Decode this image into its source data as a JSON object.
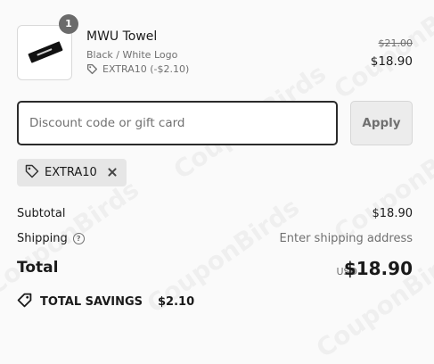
{
  "product": {
    "quantity": "1",
    "name": "MWU Towel",
    "variant": "Black / White Logo",
    "applied_discount": "EXTRA10 (-$2.10)",
    "original_price": "$21.00",
    "price": "$18.90"
  },
  "discount": {
    "placeholder": "Discount code or gift card",
    "value": "",
    "apply_label": "Apply",
    "applied_code": "EXTRA10"
  },
  "totals": {
    "subtotal_label": "Subtotal",
    "subtotal_value": "$18.90",
    "shipping_label": "Shipping",
    "shipping_value": "Enter shipping address",
    "total_label": "Total",
    "currency": "USD",
    "total_value": "$18.90",
    "savings_label": "TOTAL SAVINGS",
    "savings_value": "$2.10"
  },
  "watermark": "CouponBirds",
  "icons": [
    "tag-icon",
    "close-icon",
    "help-icon",
    "savings-tag-icon"
  ]
}
